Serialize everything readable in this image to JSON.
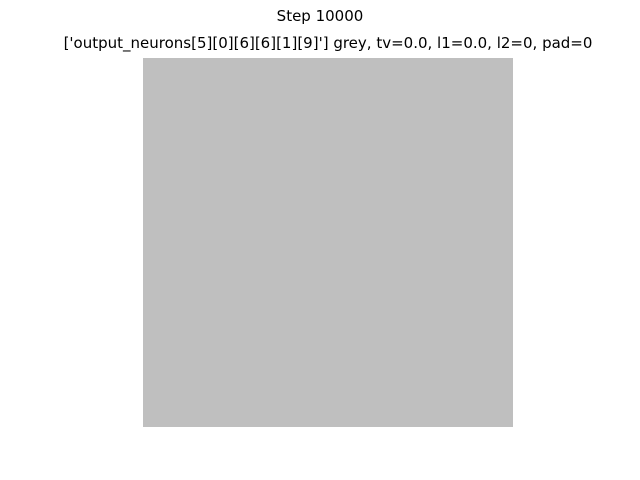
{
  "figure": {
    "suptitle": "Step 10000",
    "axes_title": "['output_neurons[5][0][6][6][1][9]'] grey, tv=0.0, l1=0.0, l2=0, pad=0",
    "image_fill_color": "#bfbfbf"
  }
}
